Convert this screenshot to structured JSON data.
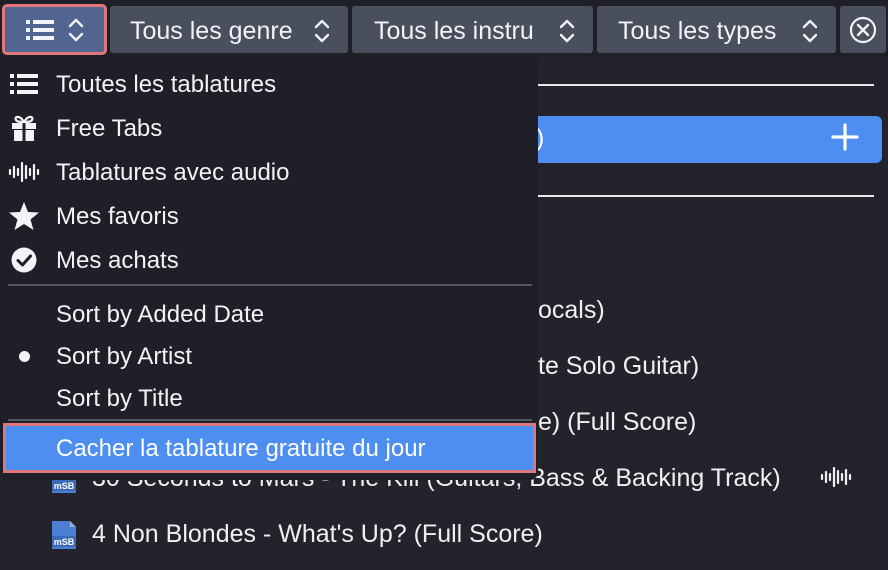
{
  "toolbar": {
    "genre_label": "Tous les genre",
    "instrument_label": "Tous les instru",
    "type_label": "Tous les types"
  },
  "menu": {
    "views": [
      {
        "label": "Toutes les tablatures",
        "icon": "list-icon"
      },
      {
        "label": "Free Tabs",
        "icon": "gift-icon"
      },
      {
        "label": "Tablatures avec audio",
        "icon": "audio-wave-icon"
      },
      {
        "label": "Mes favoris",
        "icon": "star-icon"
      },
      {
        "label": "Mes achats",
        "icon": "check-circle-icon"
      }
    ],
    "sort": [
      {
        "label": "Sort by Added Date",
        "selected": false
      },
      {
        "label": "Sort by Artist",
        "selected": true
      },
      {
        "label": "Sort by Title",
        "selected": false
      }
    ],
    "hide_free_tab_label": "Cacher la tablature gratuite du jour"
  },
  "background": {
    "pill_text": ")",
    "partial_rows": [
      "ocals)",
      "te Solo Guitar)",
      "e) (Full Score)"
    ],
    "scores": [
      {
        "title": "30 Seconds to Mars - The Kill (Guitars, Bass & Backing Track)",
        "has_audio": true,
        "file_icon": "msb-file-icon",
        "badge": "mSB"
      },
      {
        "title": "4 Non Blondes - What's Up? (Full Score)",
        "has_audio": false,
        "file_icon": "msb-file-icon",
        "badge": "mSB"
      }
    ]
  },
  "colors": {
    "background": "#23242b",
    "menu_bg": "#1f2027",
    "toolbar_button": "#4a4f5e",
    "active_button": "#526590",
    "accent_blue": "#4d8ef0",
    "highlight_outline": "#e0767a"
  }
}
